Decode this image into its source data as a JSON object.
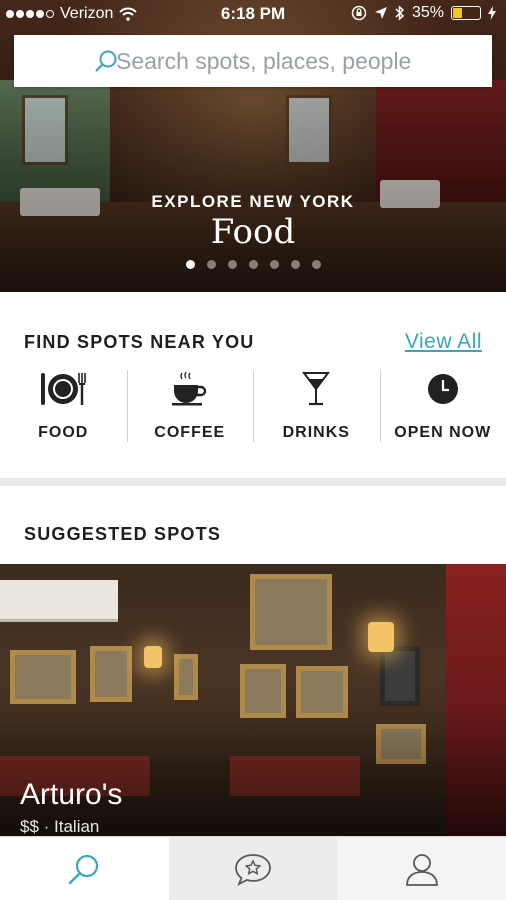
{
  "status_bar": {
    "carrier": "Verizon",
    "time": "6:18 PM",
    "battery": "35%",
    "battery_level": 0.35,
    "signal_bars_filled": 4,
    "signal_bars_total": 5
  },
  "search": {
    "placeholder": "Search spots, places, people",
    "icon": "search-icon"
  },
  "hero": {
    "eyebrow": "EXPLORE NEW YORK",
    "title": "Food",
    "carousel_pages": 7,
    "carousel_active_index": 0
  },
  "find_spots": {
    "title": "FIND SPOTS NEAR YOU",
    "view_all": "View All",
    "categories": [
      {
        "label": "FOOD",
        "icon": "plate-fork-knife-icon"
      },
      {
        "label": "COFFEE",
        "icon": "coffee-cup-icon"
      },
      {
        "label": "DRINKS",
        "icon": "cocktail-glass-icon"
      },
      {
        "label": "OPEN NOW",
        "icon": "clock-icon"
      }
    ]
  },
  "suggested": {
    "title": "SUGGESTED SPOTS",
    "spots": [
      {
        "name": "Arturo's",
        "meta": "$$ · Italian"
      }
    ]
  },
  "tabbar": {
    "tabs": [
      {
        "icon": "search-icon",
        "active": true
      },
      {
        "icon": "star-chat-bubble-icon",
        "active": false
      },
      {
        "icon": "profile-icon",
        "active": false
      }
    ]
  },
  "colors": {
    "accent": "#3aa6b9",
    "battery": "#f5c518",
    "tab_icon": "#555a5c"
  }
}
